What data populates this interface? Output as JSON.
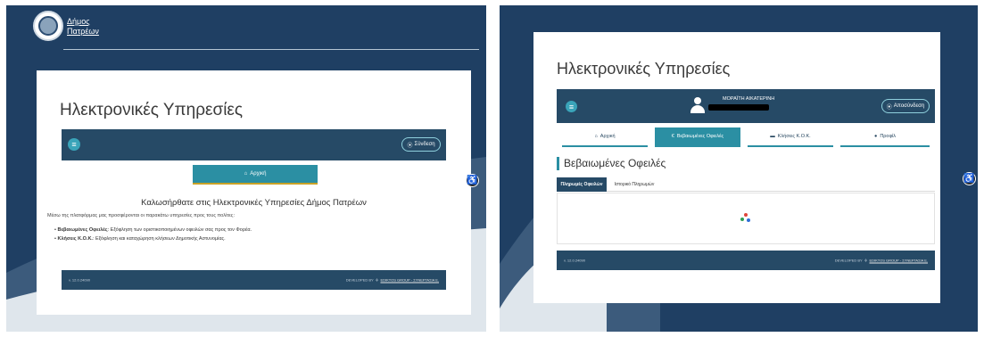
{
  "left": {
    "logo_line1": "Δήμος",
    "logo_line2": "Πατρέων",
    "page_title": "Ηλεκτρονικές Υπηρεσίες",
    "menu_icon": "hamburger-icon",
    "login_label": "Σύνδεση",
    "home_tab": "Αρχική",
    "welcome_heading": "Καλωσήρθατε στις Ηλεκτρονικές Υπηρεσίες Δήμος Πατρέων",
    "intro_text": "Μέσω της πλατφόρμας μας προσφέρονται οι παρακάτω υπηρεσίες προς τους πολίτες:",
    "services": [
      {
        "name": "Βεβαιωμένες Οφειλές",
        "desc": ": Εξόφληση των οριστικοποιημένων οφειλών σας προς τον Φορέα."
      },
      {
        "name": "Κλήσεις Κ.Ο.Κ.",
        "desc": ": Εξόφληση και καταχώρηση κλήσεων Δημοτικής Αστυνομίας."
      }
    ],
    "footer_left": "v. 12.0.24090",
    "footer_dev": "DEVELOPED BY",
    "footer_company": "EDIKTOS GROUP - ΣΥΝΕΡΓΑΣΙΑ Ε."
  },
  "right": {
    "page_title": "Ηλεκτρονικές Υπηρεσίες",
    "user_name": "ΜΟΡΑΪΤΗ ΑΙΚΑΤΕΡΙΝΗ",
    "logout_label": "Αποσύνδεση",
    "tabs": [
      {
        "label": "Αρχική",
        "icon": "home-icon",
        "active": false
      },
      {
        "label": "Βεβαιωμένες Οφειλές",
        "icon": "euro-icon",
        "active": true
      },
      {
        "label": "Κλήσεις Κ.Ο.Κ.",
        "icon": "card-icon",
        "active": false
      },
      {
        "label": "Προφίλ",
        "icon": "user-icon",
        "active": false
      }
    ],
    "section_title": "Βεβαιωμένες Οφειλές",
    "subtabs": [
      {
        "label": "Πληρωμές Οφειλών",
        "active": true
      },
      {
        "label": "Ιστορικό Πληρωμών",
        "active": false
      }
    ],
    "footer_left": "v. 12.0.24090",
    "footer_dev": "DEVELOPED BY",
    "footer_company": "EDIKTOS GROUP - ΣΥΝΕΡΓΑΣΙΑ Ε."
  },
  "colors": {
    "navy": "#264a66",
    "teal": "#2b8fa3",
    "background": "#1f3f63"
  }
}
